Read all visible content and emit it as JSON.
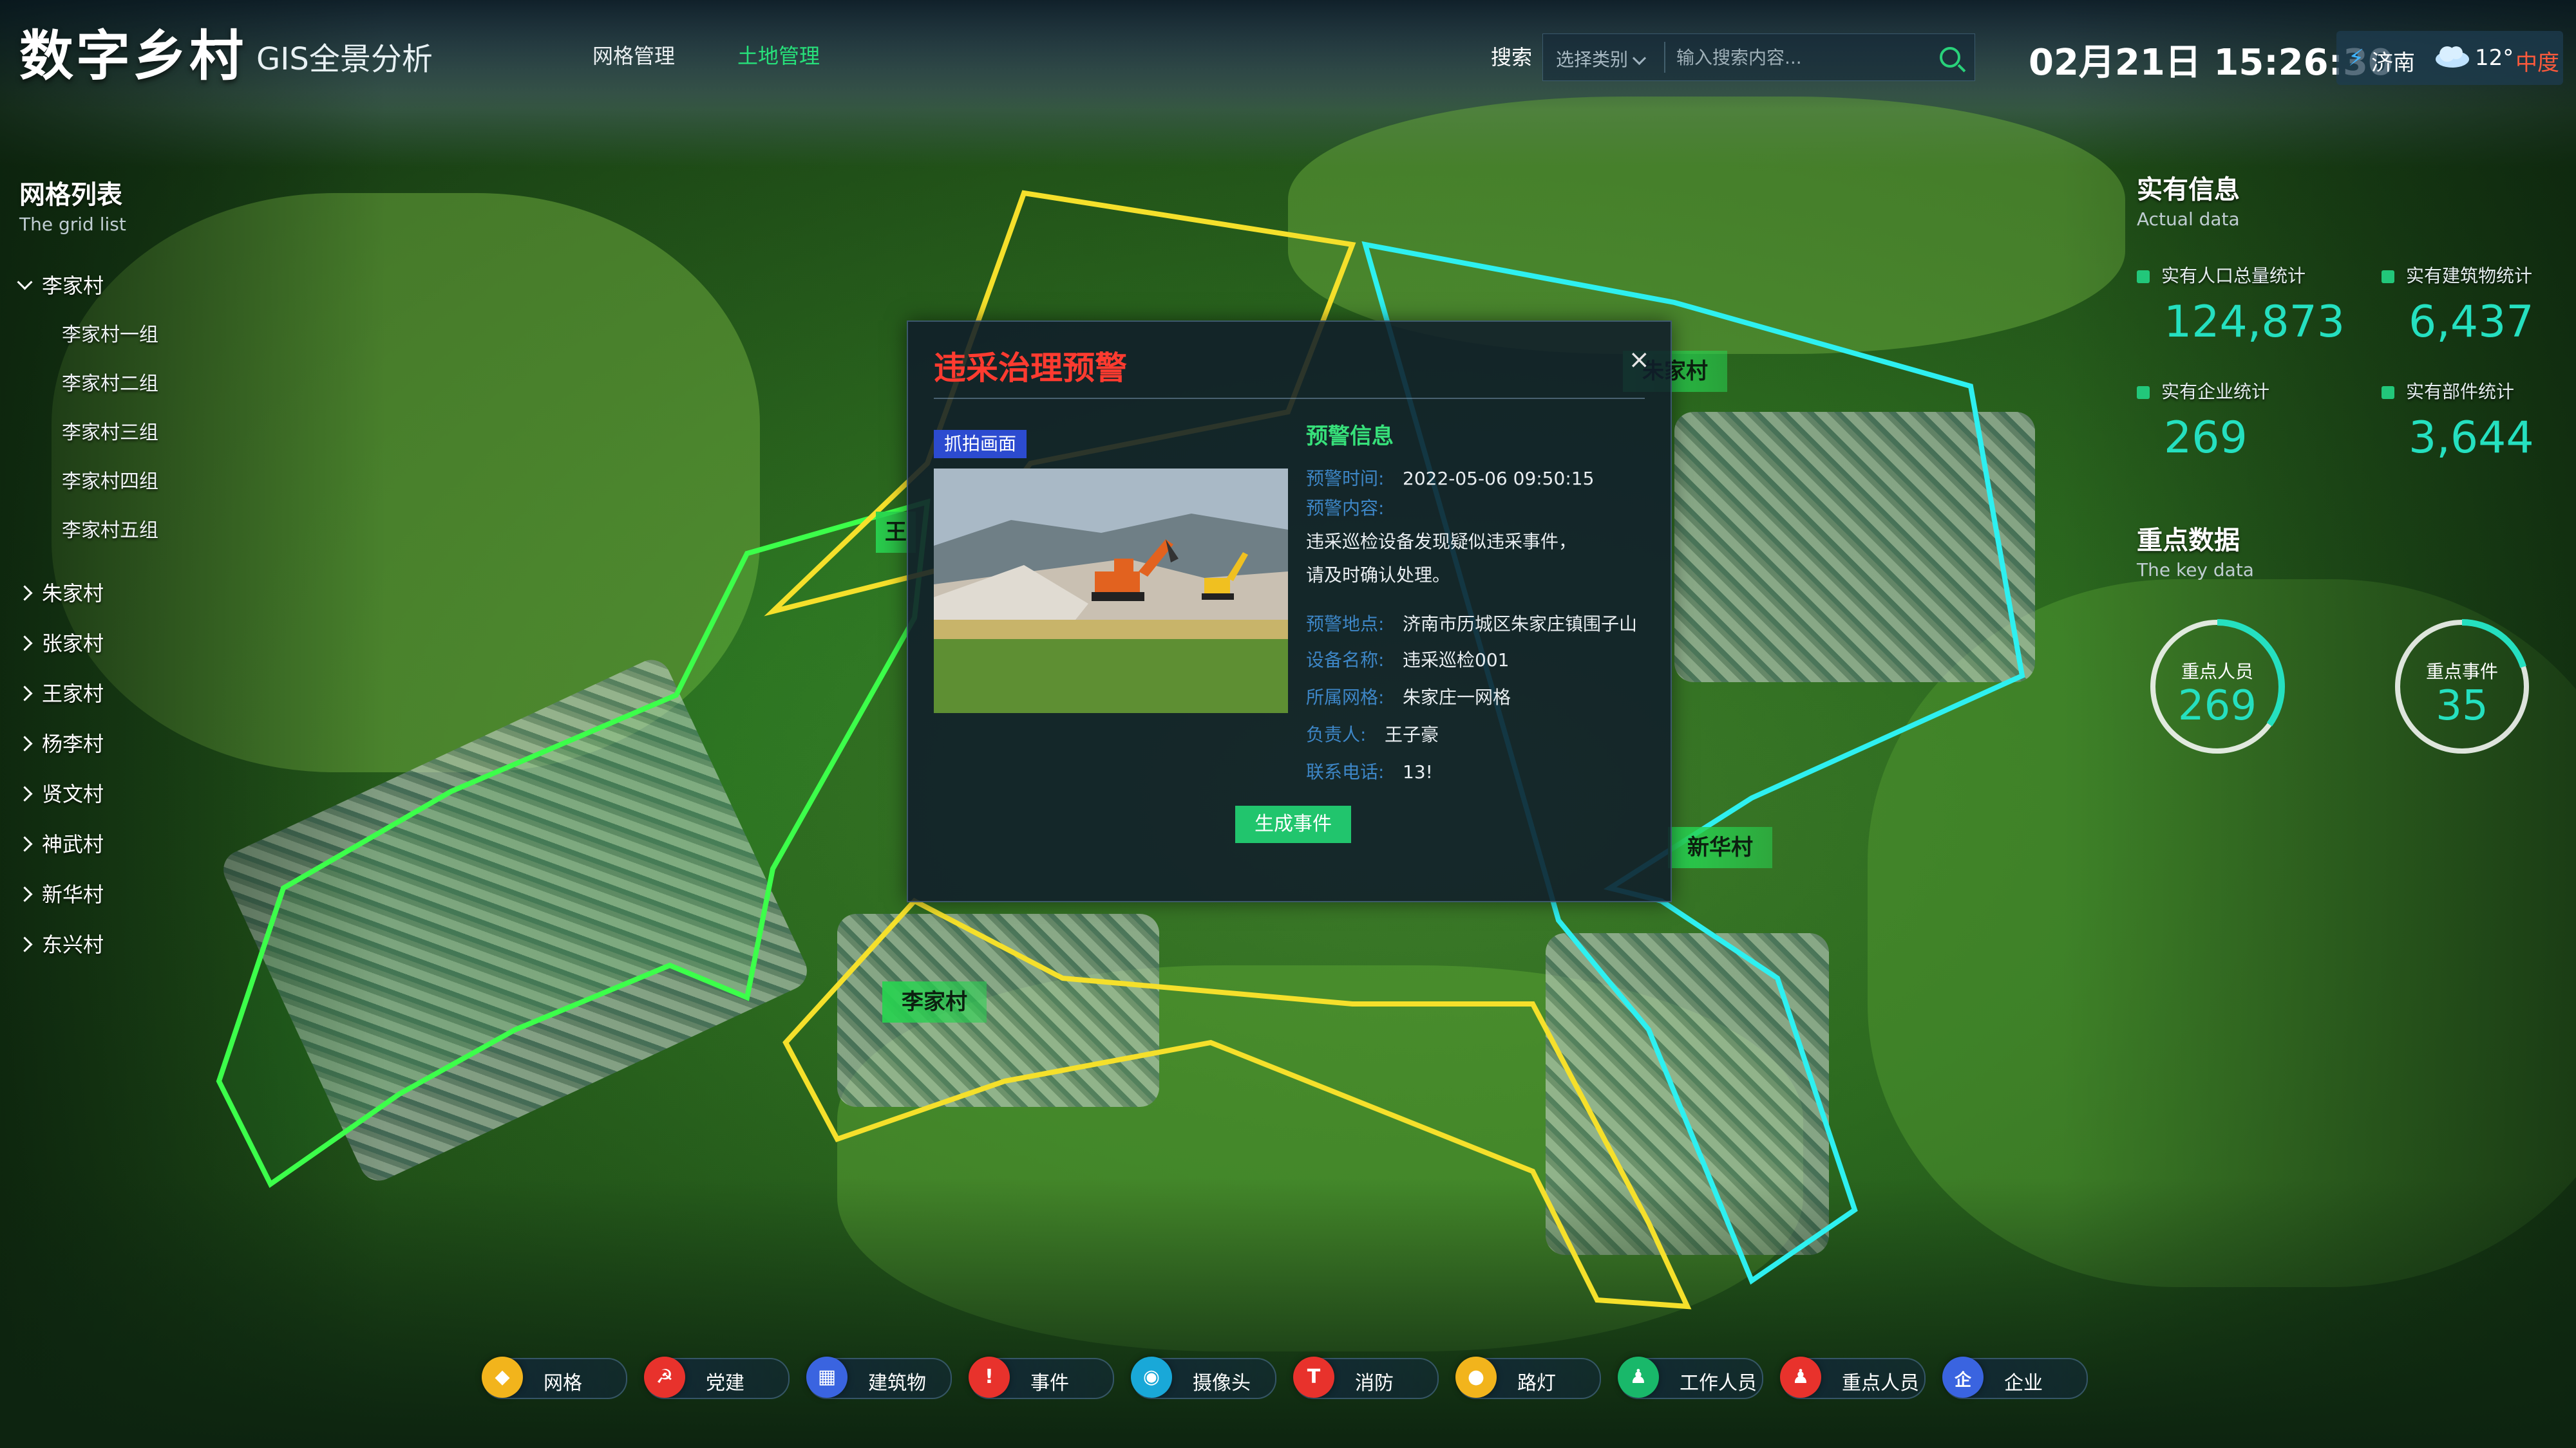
{
  "header": {
    "app_title": "数字乡村",
    "subtitle": "GIS全景分析",
    "nav": [
      "网格管理",
      "土地管理"
    ],
    "search_label": "搜索",
    "search_select": "选择类别",
    "search_placeholder": "输入搜索内容...",
    "datetime": "02月21日 15:26:30",
    "weather": {
      "city": "济南",
      "temp": "12°",
      "air": "中度"
    }
  },
  "grid_list": {
    "title": "网格列表",
    "subtitle": "The grid list",
    "villages": [
      {
        "name": "李家村",
        "children": [
          "李家村一组",
          "李家村二组",
          "李家村三组",
          "李家村四组",
          "李家村五组"
        ]
      },
      {
        "name": "朱家村"
      },
      {
        "name": "张家村"
      },
      {
        "name": "王家村"
      },
      {
        "name": "杨李村"
      },
      {
        "name": "贤文村"
      },
      {
        "name": "神武村"
      },
      {
        "name": "新华村"
      },
      {
        "name": "东兴村"
      }
    ]
  },
  "actual": {
    "title": "实有信息",
    "subtitle": "Actual data",
    "stats": [
      {
        "label": "实有人口总量统计",
        "value": "124,873"
      },
      {
        "label": "实有建筑物统计",
        "value": "6,437"
      },
      {
        "label": "实有企业统计",
        "value": "269"
      },
      {
        "label": "实有部件统计",
        "value": "3,644"
      }
    ]
  },
  "key_data": {
    "title": "重点数据",
    "subtitle": "The key data",
    "rings": [
      {
        "label": "重点人员",
        "value": "269",
        "fraction": 0.35
      },
      {
        "label": "重点事件",
        "value": "35",
        "fraction": 0.2
      }
    ]
  },
  "map_labels": [
    "朱家村",
    "新华村",
    "李家村",
    "王"
  ],
  "popup": {
    "title": "违采治理预警",
    "close": "×",
    "capture_tag": "抓拍画面",
    "info_title": "预警信息",
    "rows": [
      {
        "k": "预警时间:",
        "v": "2022-05-06  09:50:15"
      },
      {
        "k": "预警内容:",
        "v": "违采巡检设备发现疑似违采事件，请及时确认处理。"
      },
      {
        "k": "预警地点:",
        "v": "济南市历城区朱家庄镇围子山"
      },
      {
        "k": "设备名称:",
        "v": "违采巡检001"
      },
      {
        "k": "所属网格:",
        "v": "朱家庄一网格"
      },
      {
        "k": "负责人:",
        "v": "王子豪"
      },
      {
        "k": "联系电话:",
        "v": "13!"
      }
    ],
    "button": "生成事件"
  },
  "toolbar": [
    {
      "label": "网格",
      "icon": "grid-icon",
      "color": "#f2b41c",
      "sym": "◆"
    },
    {
      "label": "党建",
      "icon": "party-icon",
      "color": "#e8322c",
      "sym": "☭"
    },
    {
      "label": "建筑物",
      "icon": "building-icon",
      "color": "#3a64e0",
      "sym": "▦"
    },
    {
      "label": "事件",
      "icon": "event-icon",
      "color": "#e8322c",
      "sym": "!"
    },
    {
      "label": "摄像头",
      "icon": "camera-icon",
      "color": "#19a8d8",
      "sym": "◉"
    },
    {
      "label": "消防",
      "icon": "fire-icon",
      "color": "#e8322c",
      "sym": "T"
    },
    {
      "label": "路灯",
      "icon": "streetlight-icon",
      "color": "#f2b41c",
      "sym": "●"
    },
    {
      "label": "工作人员",
      "icon": "staff-icon",
      "color": "#19b86a",
      "sym": "♟"
    },
    {
      "label": "重点人员",
      "icon": "key-person-icon",
      "color": "#e8322c",
      "sym": "♟"
    },
    {
      "label": "企业",
      "icon": "enterprise-icon",
      "color": "#3a64e0",
      "sym": "企"
    }
  ],
  "colors": {
    "accent": "#25e0c0",
    "alert": "#ff3b30",
    "green": "#21c56d"
  }
}
